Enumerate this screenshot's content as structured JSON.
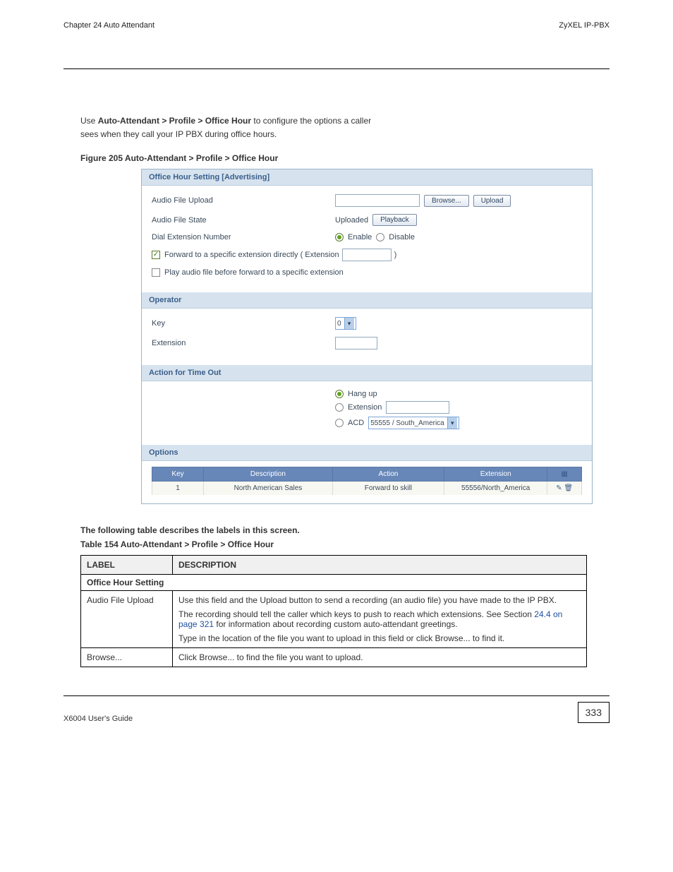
{
  "header": {
    "chapter": "Chapter 24 Auto Attendant",
    "subtitle": "ZyXEL IP-PBX"
  },
  "intro": {
    "line1_prefix": "Use ",
    "line1_bold": "Auto-Attendant > Profile > Office Hour",
    "line1_suffix": " to configure the options a caller ",
    "line2": "sees when they call your IP PBX during office hours."
  },
  "figure_caption": "Figure 205   Auto-Attendant > Profile > Office Hour",
  "shot": {
    "section1_title": "Office Hour Setting [Advertising]",
    "audio_upload_label": "Audio File Upload",
    "browse_label": "Browse...",
    "upload_label": "Upload",
    "audio_state_label": "Audio File State",
    "audio_state_value": "Uploaded",
    "playback_label": "Playback",
    "dial_ext_label": "Dial Extension Number",
    "enable_label": "Enable",
    "disable_label": "Disable",
    "fwd_label_pre": "Forward to a specific extension directly ( Extension",
    "fwd_label_post": ")",
    "play_before_label": "Play audio file before forward to a specific extension",
    "operator_title": "Operator",
    "key_label": "Key",
    "key_value": "0",
    "extension_label": "Extension",
    "timeout_title": "Action for Time Out",
    "hangup_label": "Hang up",
    "timeout_ext_label": "Extension",
    "acd_label": "ACD",
    "acd_value": "55555 / South_America",
    "options_title": "Options",
    "opt_headers": {
      "key": "Key",
      "desc": "Description",
      "action": "Action",
      "ext": "Extension"
    },
    "opt_row": {
      "key": "1",
      "desc": "North American Sales",
      "action": "Forward to skill",
      "ext": "55556/North_America"
    }
  },
  "doc_table": {
    "caption": "The following table describes the labels in this screen.",
    "title": "Table 154   Auto-Attendant > Profile > Office Hour",
    "col_label": "LABEL",
    "col_desc": "DESCRIPTION",
    "section_row": "Office Hour Setting",
    "rows": [
      {
        "label": "Audio File Upload",
        "desc_top": "Use this field and the Upload button to send a recording (an audio file) you have made to the IP PBX.",
        "desc_mid": "The recording should tell the caller which keys to push to reach which extensions. See Section ",
        "desc_mid_link": "24.4 on page 321",
        "desc_mid2": " for information about recording custom auto-attendant greetings.",
        "desc_bot": "Type in the location of the file you want to upload in this field or click Browse... to find it."
      },
      {
        "label": "Browse...",
        "desc": "Click Browse... to find the file you want to upload."
      }
    ]
  },
  "footer": {
    "manual": "X6004 User's Guide",
    "page": "333"
  }
}
